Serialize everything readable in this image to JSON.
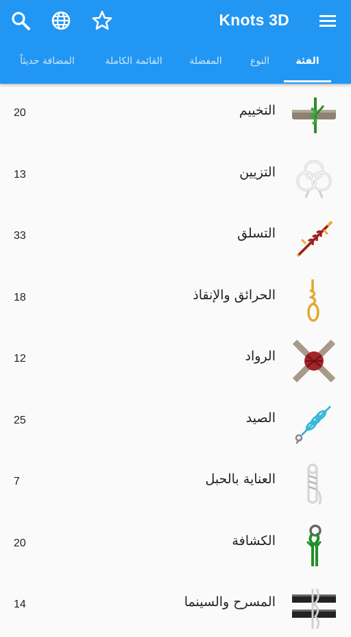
{
  "app": {
    "title": "Knots 3D",
    "icons": [
      "search-icon",
      "globe-icon",
      "star-icon",
      "menu-icon"
    ]
  },
  "tabs": [
    {
      "label": "الفئة",
      "active": true
    },
    {
      "label": "النوع",
      "active": false
    },
    {
      "label": "المفضلة",
      "active": false
    },
    {
      "label": "القائمة الكاملة",
      "active": false
    },
    {
      "label": "المضافة حديثاً",
      "active": false
    }
  ],
  "categories": [
    {
      "label": "التخييم",
      "count": "20",
      "icon": "camping-knot-icon"
    },
    {
      "label": "التزيين",
      "count": "13",
      "icon": "decorative-knot-icon"
    },
    {
      "label": "التسلق",
      "count": "33",
      "icon": "climbing-knot-icon"
    },
    {
      "label": "الحرائق والإنقاذ",
      "count": "18",
      "icon": "fire-rescue-knot-icon"
    },
    {
      "label": "الرواد",
      "count": "12",
      "icon": "pioneering-knot-icon"
    },
    {
      "label": "الصيد",
      "count": "25",
      "icon": "fishing-knot-icon"
    },
    {
      "label": "العناية بالحبل",
      "count": "7",
      "icon": "rope-care-icon"
    },
    {
      "label": "الكشافة",
      "count": "20",
      "icon": "scouting-knot-icon"
    },
    {
      "label": "المسرح والسينما",
      "count": "14",
      "icon": "stage-knot-icon"
    }
  ],
  "colors": {
    "primary": "#2196f3",
    "background": "#fafafa",
    "text": "#222222"
  }
}
